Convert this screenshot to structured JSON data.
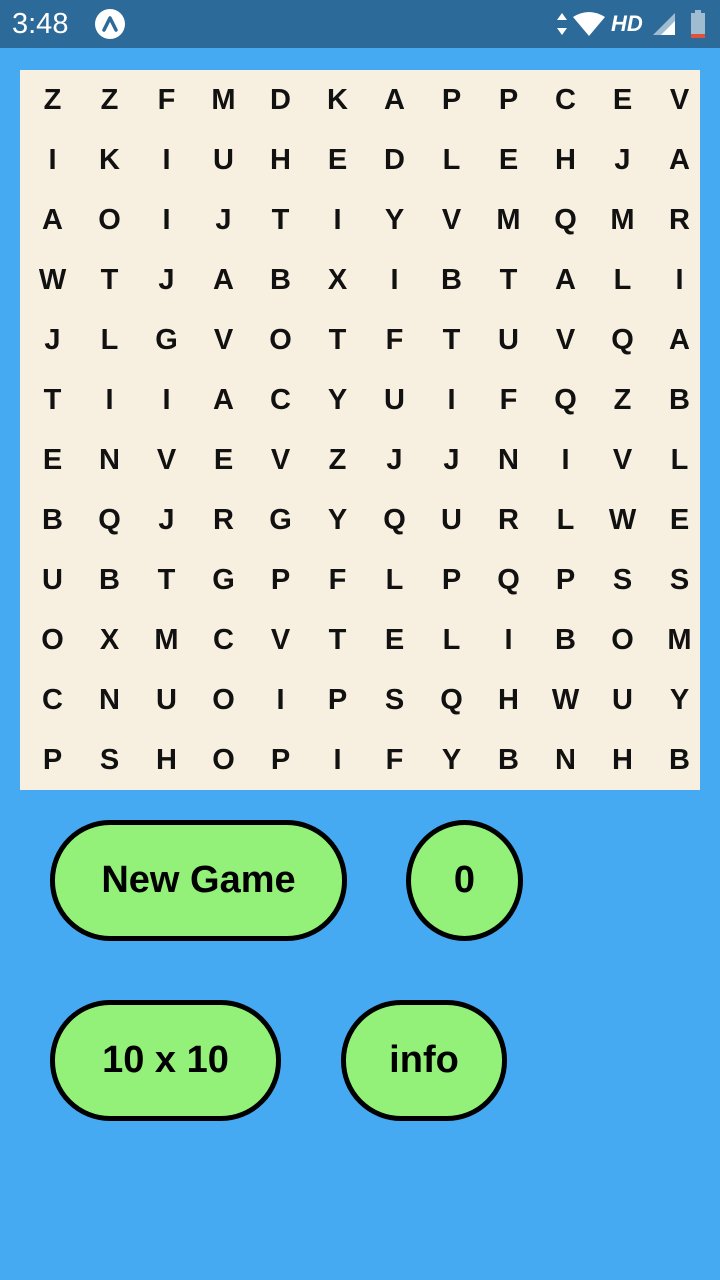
{
  "status_bar": {
    "time": "3:48",
    "network": "HD",
    "app_icon": "autonomous-a-icon",
    "icons": [
      "data-arrows-icon",
      "wifi-icon",
      "signal-icon",
      "battery-icon"
    ],
    "background": "#2C6A99"
  },
  "colors": {
    "background": "#45AAF2",
    "board": "#F7EFDF",
    "button_fill": "#93F078",
    "button_border": "#000000"
  },
  "grid": {
    "rows": [
      [
        "Z",
        "Z",
        "F",
        "M",
        "D",
        "K",
        "A",
        "P",
        "P",
        "C",
        "E",
        "V"
      ],
      [
        "I",
        "K",
        "I",
        "U",
        "H",
        "E",
        "D",
        "L",
        "E",
        "H",
        "J",
        "A"
      ],
      [
        "A",
        "O",
        "I",
        "J",
        "T",
        "I",
        "Y",
        "V",
        "M",
        "Q",
        "M",
        "R"
      ],
      [
        "W",
        "T",
        "J",
        "A",
        "B",
        "X",
        "I",
        "B",
        "T",
        "A",
        "L",
        "I"
      ],
      [
        "J",
        "L",
        "G",
        "V",
        "O",
        "T",
        "F",
        "T",
        "U",
        "V",
        "Q",
        "A"
      ],
      [
        "T",
        "I",
        "I",
        "A",
        "C",
        "Y",
        "U",
        "I",
        "F",
        "Q",
        "Z",
        "B"
      ],
      [
        "E",
        "N",
        "V",
        "E",
        "V",
        "Z",
        "J",
        "J",
        "N",
        "I",
        "V",
        "L"
      ],
      [
        "B",
        "Q",
        "J",
        "R",
        "G",
        "Y",
        "Q",
        "U",
        "R",
        "L",
        "W",
        "E"
      ],
      [
        "U",
        "B",
        "T",
        "G",
        "P",
        "F",
        "L",
        "P",
        "Q",
        "P",
        "S",
        "S"
      ],
      [
        "O",
        "X",
        "M",
        "C",
        "V",
        "T",
        "E",
        "L",
        "I",
        "B",
        "O",
        "M"
      ],
      [
        "C",
        "N",
        "U",
        "O",
        "I",
        "P",
        "S",
        "Q",
        "H",
        "W",
        "U",
        "Y"
      ],
      [
        "P",
        "S",
        "H",
        "O",
        "P",
        "I",
        "F",
        "Y",
        "B",
        "N",
        "H",
        "B"
      ]
    ]
  },
  "controls": {
    "new_game_label": "New Game",
    "score": "0",
    "size_label": "10 x 10",
    "info_label": "info"
  }
}
